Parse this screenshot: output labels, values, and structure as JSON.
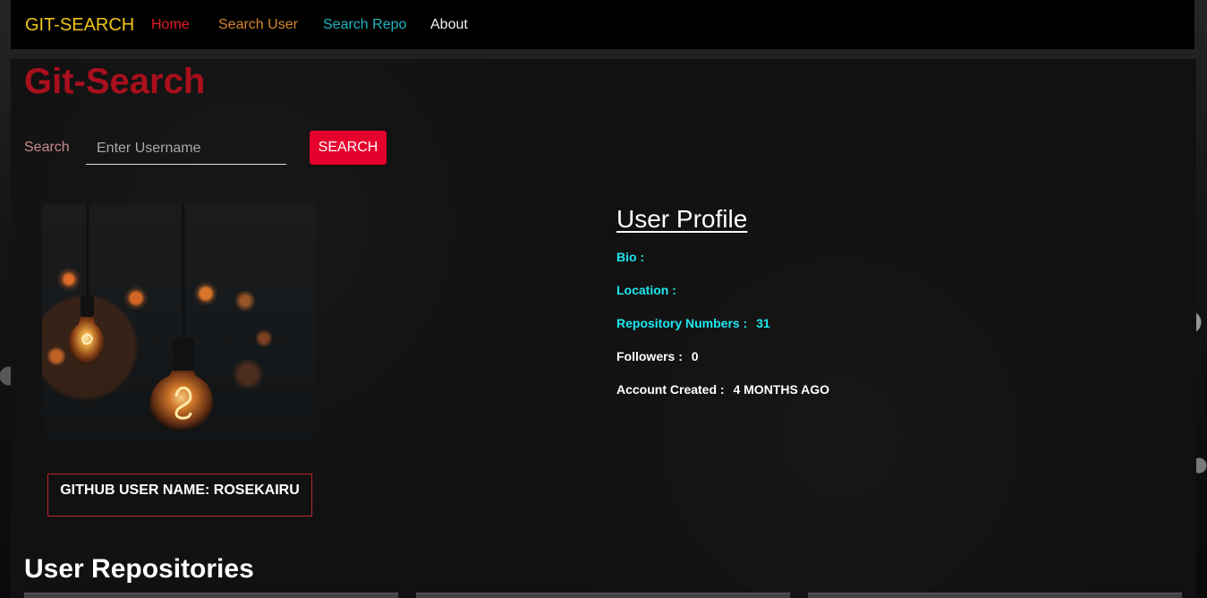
{
  "navbar": {
    "brand": "GIT-SEARCH",
    "links": [
      {
        "label": "Home",
        "color": "#e21b23"
      },
      {
        "label": "Search User",
        "color": "#d78429"
      },
      {
        "label": "Search Repo",
        "color": "#1fb5c1"
      },
      {
        "label": "About",
        "color": "#f2f2f2"
      }
    ]
  },
  "page": {
    "title": "Git-Search"
  },
  "search": {
    "label": "Search",
    "placeholder": "Enter Username",
    "value": "",
    "button_label": "SEARCH"
  },
  "profile": {
    "github_user_name_label": "GITHUB USER NAME: ROSEKAIRU",
    "title": "User Profile",
    "rows": [
      {
        "label": "Bio :",
        "value": "",
        "color": "#1de8f0"
      },
      {
        "label": "Location :",
        "value": "",
        "color": "#1de8f0"
      },
      {
        "label": "Repository Numbers :",
        "value": "31",
        "color": "#1de8f0"
      },
      {
        "label": "Followers :",
        "value": "0",
        "color": "#ffffff"
      },
      {
        "label": "Account Created :",
        "value": "4 MONTHS AGO",
        "color": "#ffffff"
      }
    ]
  },
  "repositories": {
    "title": "User Repositories"
  },
  "icons": {
    "avatar": "light-bulb-photo"
  },
  "colors": {
    "brand": "#f0c419",
    "title": "#a90f1d",
    "accent_button": "#e6002d",
    "highlight": "#1de8f0"
  }
}
